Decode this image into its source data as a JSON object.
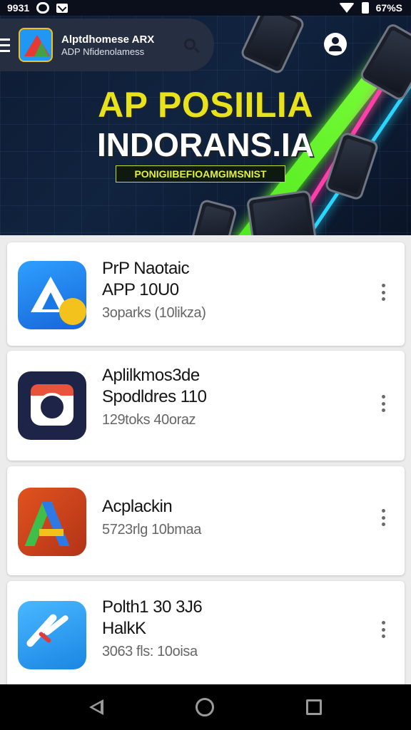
{
  "status_bar": {
    "time": "9931",
    "right_text": "67%S"
  },
  "app_bar": {
    "title": "Alptdhomese ARX",
    "subtitle": "ADP Nfidenolamess"
  },
  "hero": {
    "title_line1": "AP POSIILIA",
    "title_line2": "INDORANS.IA",
    "tagline": "PONIGIIBEFIOAMGIMSNIST"
  },
  "apps": [
    {
      "name_line1": "PrP Naotaic",
      "name_line2": "APP 10U0",
      "meta": "3oparks (10likza)",
      "icon": "blue-triangle-icon"
    },
    {
      "name_line1": "Aplilkmos3de",
      "name_line2": "Spodldres 110",
      "meta": "129toks 40oraz",
      "icon": "camera-icon"
    },
    {
      "name_line1": "Acplackin",
      "name_line2": "",
      "meta": "5723rlg 10bmaa",
      "icon": "letter-a-icon"
    },
    {
      "name_line1": "Polth1 30 3J6",
      "name_line2": "HalkK",
      "meta": "3063 fls: 10oisa",
      "icon": "zigzag-arrow-icon"
    }
  ],
  "colors": {
    "hero_yellow": "#e8e21c",
    "accent_green": "#49e51a",
    "card_bg": "#ffffff",
    "nav_bg": "#000000"
  }
}
